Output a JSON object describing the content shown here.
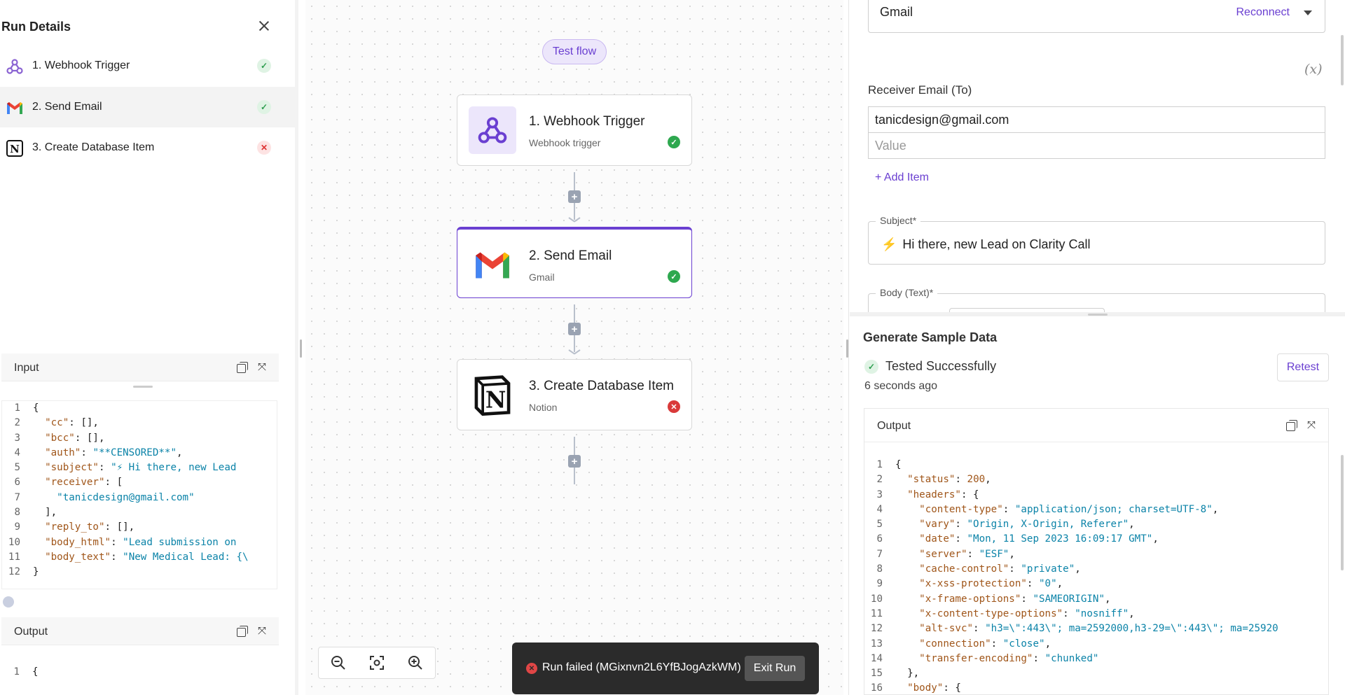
{
  "run_details": {
    "title": "Run Details",
    "steps": [
      {
        "label": "1. Webhook Trigger",
        "status": "success"
      },
      {
        "label": "2. Send Email",
        "status": "success"
      },
      {
        "label": "3. Create Database Item",
        "status": "failed"
      }
    ]
  },
  "input_panel": {
    "title": "Input",
    "lines": [
      [
        {
          "t": "p",
          "v": "{"
        }
      ],
      [
        {
          "t": "p",
          "v": "  "
        },
        {
          "t": "k",
          "v": "\"cc\""
        },
        {
          "t": "p",
          "v": ": [],"
        }
      ],
      [
        {
          "t": "p",
          "v": "  "
        },
        {
          "t": "k",
          "v": "\"bcc\""
        },
        {
          "t": "p",
          "v": ": [],"
        }
      ],
      [
        {
          "t": "p",
          "v": "  "
        },
        {
          "t": "k",
          "v": "\"auth\""
        },
        {
          "t": "p",
          "v": ": "
        },
        {
          "t": "s",
          "v": "\"**CENSORED**\""
        },
        {
          "t": "p",
          "v": ","
        }
      ],
      [
        {
          "t": "p",
          "v": "  "
        },
        {
          "t": "k",
          "v": "\"subject\""
        },
        {
          "t": "p",
          "v": ": "
        },
        {
          "t": "s",
          "v": "\"⚡ Hi there, new Lead"
        }
      ],
      [
        {
          "t": "p",
          "v": "  "
        },
        {
          "t": "k",
          "v": "\"receiver\""
        },
        {
          "t": "p",
          "v": ": ["
        }
      ],
      [
        {
          "t": "p",
          "v": "    "
        },
        {
          "t": "s",
          "v": "\"tanicdesign@gmail.com\""
        }
      ],
      [
        {
          "t": "p",
          "v": "  ],"
        }
      ],
      [
        {
          "t": "p",
          "v": "  "
        },
        {
          "t": "k",
          "v": "\"reply_to\""
        },
        {
          "t": "p",
          "v": ": [],"
        }
      ],
      [
        {
          "t": "p",
          "v": "  "
        },
        {
          "t": "k",
          "v": "\"body_html\""
        },
        {
          "t": "p",
          "v": ": "
        },
        {
          "t": "s",
          "v": "\"Lead submission on "
        }
      ],
      [
        {
          "t": "p",
          "v": "  "
        },
        {
          "t": "k",
          "v": "\"body_text\""
        },
        {
          "t": "p",
          "v": ": "
        },
        {
          "t": "s",
          "v": "\"New Medical Lead: {\\"
        }
      ],
      [
        {
          "t": "p",
          "v": "}"
        }
      ]
    ]
  },
  "output_panel_left": {
    "title": "Output",
    "lines": [
      [
        {
          "t": "p",
          "v": "{"
        }
      ]
    ]
  },
  "canvas": {
    "test_flow_label": "Test flow",
    "nodes": [
      {
        "title": "1. Webhook Trigger",
        "subtitle": "Webhook trigger",
        "status": "success"
      },
      {
        "title": "2. Send Email",
        "subtitle": "Gmail",
        "status": "success"
      },
      {
        "title": "3. Create Database Item",
        "subtitle": "Notion",
        "status": "failed"
      }
    ]
  },
  "toast": {
    "message": "Run failed (MGixnvn2L6YfBJogAzkWM)",
    "exit_label": "Exit Run"
  },
  "right_panel": {
    "connection_value": "Gmail",
    "reconnect_label": "Reconnect",
    "fx_label": "(x)",
    "receiver_label": "Receiver Email (To)",
    "receiver_value": "tanicdesign@gmail.com",
    "value_placeholder": "Value",
    "add_item_label": "+ Add Item",
    "subject_label": "Subject*",
    "subject_value": "Hi there, new Lead on Clarity Call",
    "body_label": "Body (Text)*",
    "sample_title": "Generate Sample Data",
    "tested_label": "Tested Successfully",
    "tested_ago": "6 seconds ago",
    "retest_label": "Retest",
    "output_title": "Output",
    "output_lines": [
      [
        {
          "t": "p",
          "v": "{"
        }
      ],
      [
        {
          "t": "p",
          "v": "  "
        },
        {
          "t": "k",
          "v": "\"status\""
        },
        {
          "t": "p",
          "v": ": "
        },
        {
          "t": "n",
          "v": "200"
        },
        {
          "t": "p",
          "v": ","
        }
      ],
      [
        {
          "t": "p",
          "v": "  "
        },
        {
          "t": "k",
          "v": "\"headers\""
        },
        {
          "t": "p",
          "v": ": {"
        }
      ],
      [
        {
          "t": "p",
          "v": "    "
        },
        {
          "t": "k",
          "v": "\"content-type\""
        },
        {
          "t": "p",
          "v": ": "
        },
        {
          "t": "s",
          "v": "\"application/json; charset=UTF-8\""
        },
        {
          "t": "p",
          "v": ","
        }
      ],
      [
        {
          "t": "p",
          "v": "    "
        },
        {
          "t": "k",
          "v": "\"vary\""
        },
        {
          "t": "p",
          "v": ": "
        },
        {
          "t": "s",
          "v": "\"Origin, X-Origin, Referer\""
        },
        {
          "t": "p",
          "v": ","
        }
      ],
      [
        {
          "t": "p",
          "v": "    "
        },
        {
          "t": "k",
          "v": "\"date\""
        },
        {
          "t": "p",
          "v": ": "
        },
        {
          "t": "s",
          "v": "\"Mon, 11 Sep 2023 16:09:17 GMT\""
        },
        {
          "t": "p",
          "v": ","
        }
      ],
      [
        {
          "t": "p",
          "v": "    "
        },
        {
          "t": "k",
          "v": "\"server\""
        },
        {
          "t": "p",
          "v": ": "
        },
        {
          "t": "s",
          "v": "\"ESF\""
        },
        {
          "t": "p",
          "v": ","
        }
      ],
      [
        {
          "t": "p",
          "v": "    "
        },
        {
          "t": "k",
          "v": "\"cache-control\""
        },
        {
          "t": "p",
          "v": ": "
        },
        {
          "t": "s",
          "v": "\"private\""
        },
        {
          "t": "p",
          "v": ","
        }
      ],
      [
        {
          "t": "p",
          "v": "    "
        },
        {
          "t": "k",
          "v": "\"x-xss-protection\""
        },
        {
          "t": "p",
          "v": ": "
        },
        {
          "t": "s",
          "v": "\"0\""
        },
        {
          "t": "p",
          "v": ","
        }
      ],
      [
        {
          "t": "p",
          "v": "    "
        },
        {
          "t": "k",
          "v": "\"x-frame-options\""
        },
        {
          "t": "p",
          "v": ": "
        },
        {
          "t": "s",
          "v": "\"SAMEORIGIN\""
        },
        {
          "t": "p",
          "v": ","
        }
      ],
      [
        {
          "t": "p",
          "v": "    "
        },
        {
          "t": "k",
          "v": "\"x-content-type-options\""
        },
        {
          "t": "p",
          "v": ": "
        },
        {
          "t": "s",
          "v": "\"nosniff\""
        },
        {
          "t": "p",
          "v": ","
        }
      ],
      [
        {
          "t": "p",
          "v": "    "
        },
        {
          "t": "k",
          "v": "\"alt-svc\""
        },
        {
          "t": "p",
          "v": ": "
        },
        {
          "t": "s",
          "v": "\"h3=\\\":443\\\"; ma=2592000,h3-29=\\\":443\\\"; ma=25920"
        }
      ],
      [
        {
          "t": "p",
          "v": "    "
        },
        {
          "t": "k",
          "v": "\"connection\""
        },
        {
          "t": "p",
          "v": ": "
        },
        {
          "t": "s",
          "v": "\"close\""
        },
        {
          "t": "p",
          "v": ","
        }
      ],
      [
        {
          "t": "p",
          "v": "    "
        },
        {
          "t": "k",
          "v": "\"transfer-encoding\""
        },
        {
          "t": "p",
          "v": ": "
        },
        {
          "t": "s",
          "v": "\"chunked\""
        }
      ],
      [
        {
          "t": "p",
          "v": "  },"
        }
      ],
      [
        {
          "t": "p",
          "v": "  "
        },
        {
          "t": "k",
          "v": "\"body\""
        },
        {
          "t": "p",
          "v": ": {"
        }
      ]
    ]
  },
  "colors": {
    "accent": "#6a3fd1",
    "success": "#2ea84f",
    "error": "#d93a3a",
    "code_key": "#a0561a",
    "code_string": "#0b83a8"
  }
}
